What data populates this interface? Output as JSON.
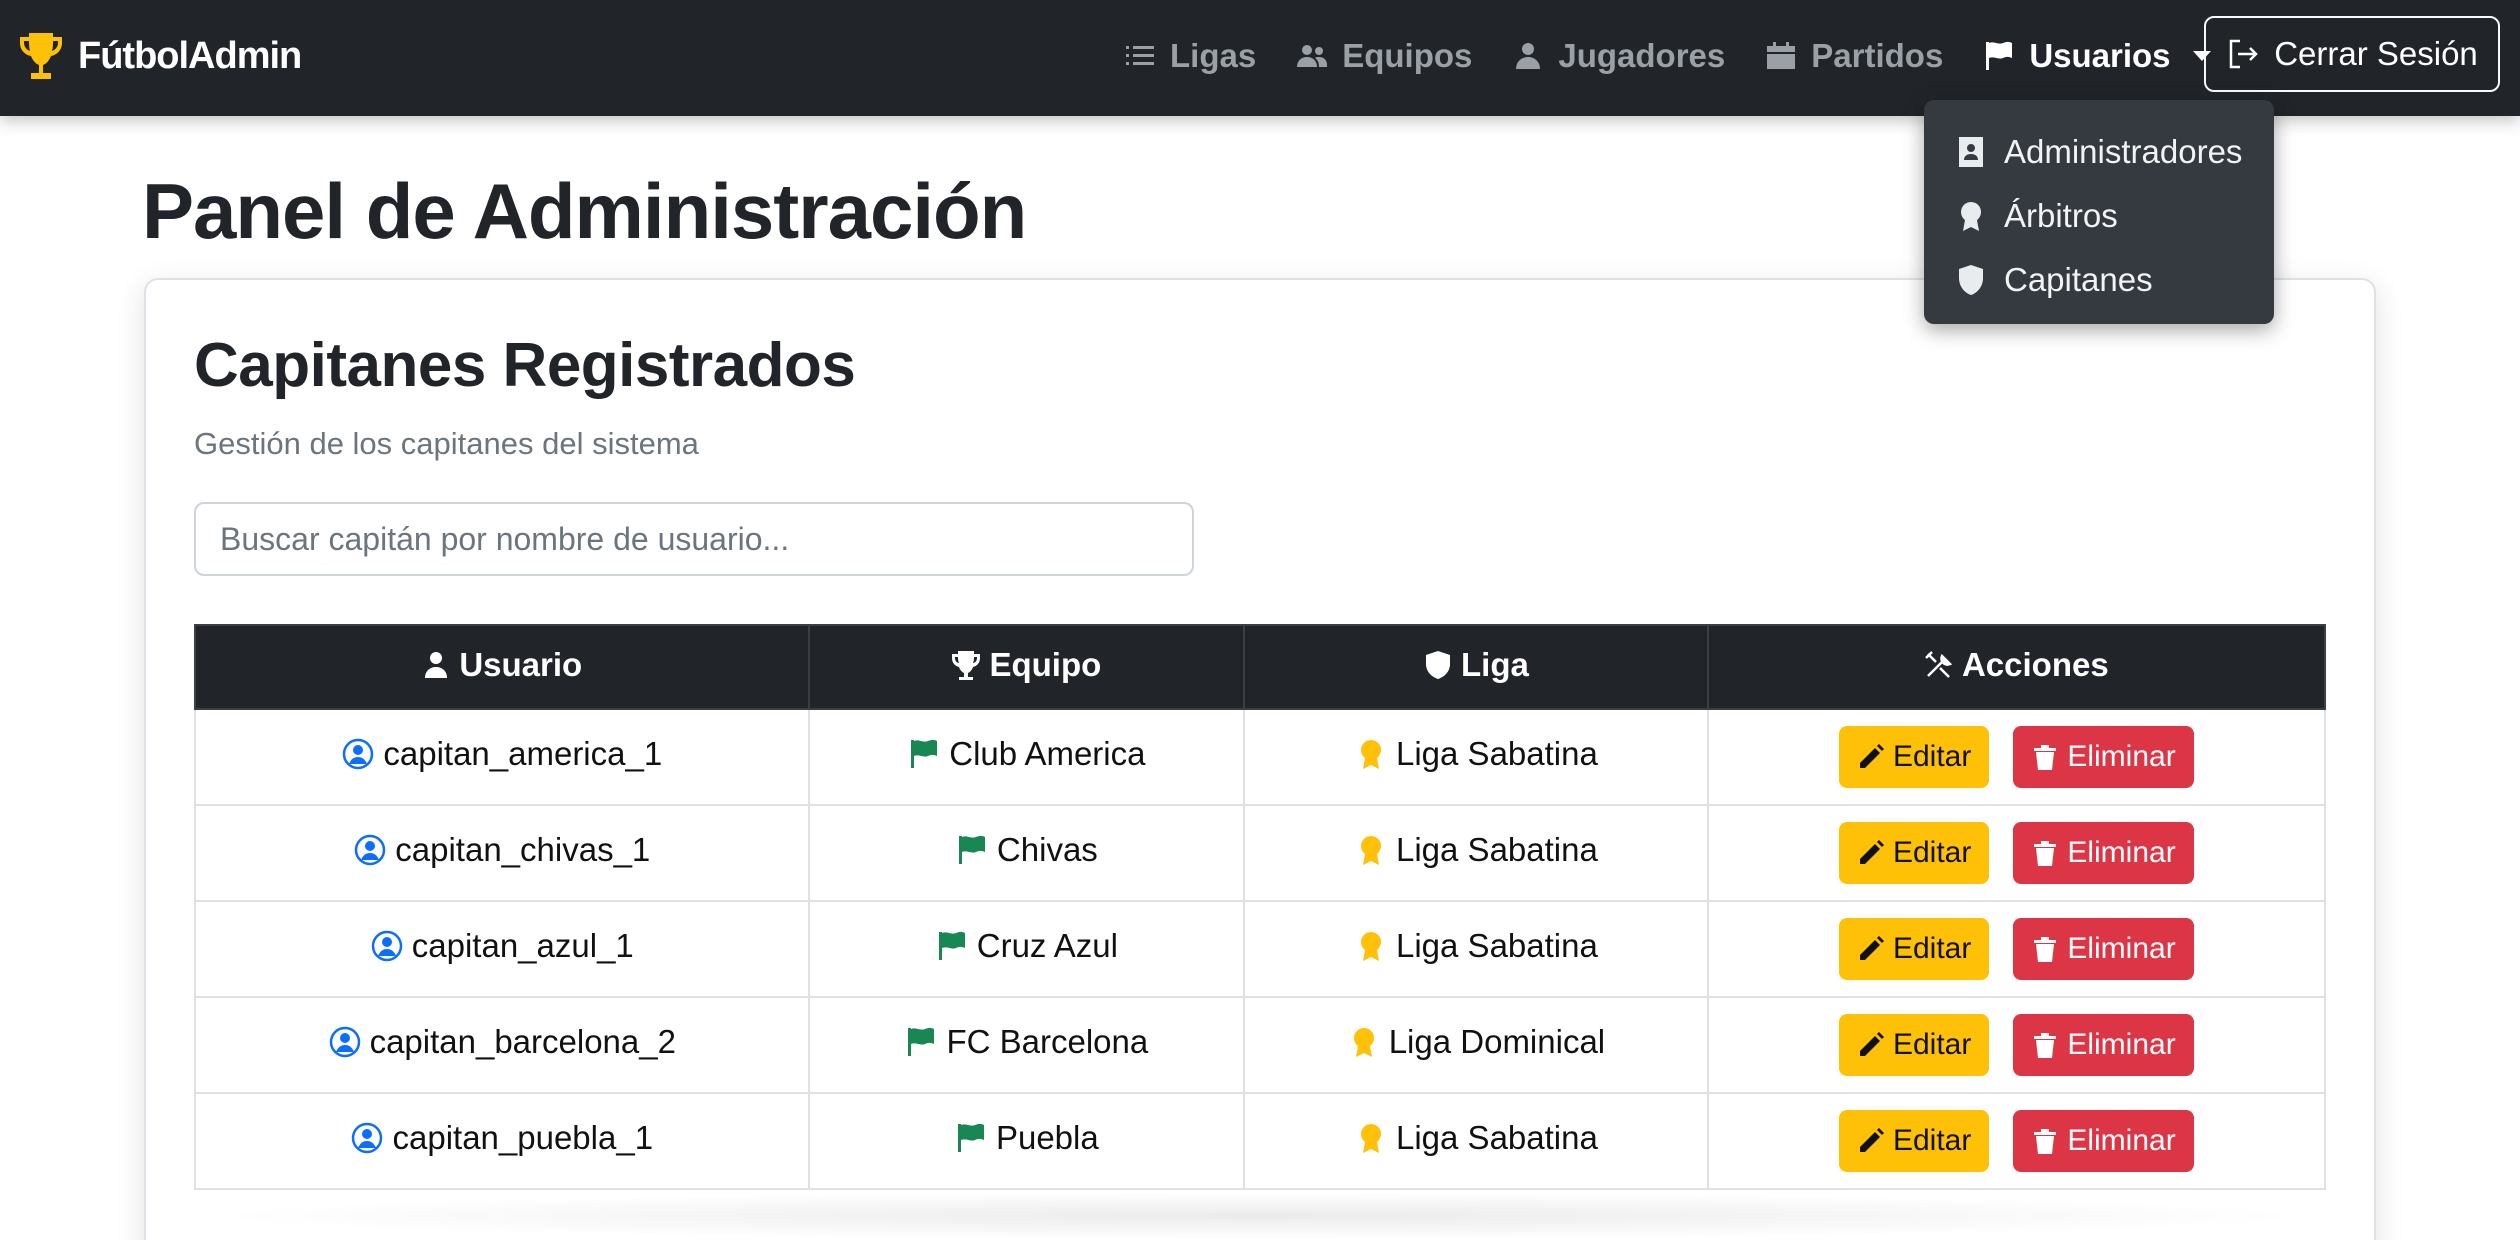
{
  "navbar": {
    "brand": "FútbolAdmin",
    "links": [
      {
        "label": "Ligas",
        "icon": "list-icon"
      },
      {
        "label": "Equipos",
        "icon": "users-icon"
      },
      {
        "label": "Jugadores",
        "icon": "user-icon"
      },
      {
        "label": "Partidos",
        "icon": "calendar-icon"
      },
      {
        "label": "Usuarios",
        "icon": "flag-icon",
        "active": true
      }
    ],
    "logout_label": "Cerrar Sesión"
  },
  "dropdown": {
    "items": [
      {
        "label": "Administradores",
        "icon": "id-badge-icon"
      },
      {
        "label": "Árbitros",
        "icon": "award-icon"
      },
      {
        "label": "Capitanes",
        "icon": "shield-icon"
      }
    ]
  },
  "main": {
    "page_title": "Panel de Administración",
    "card_title": "Capitanes Registrados",
    "card_subtitle": "Gestión de los capitanes del sistema",
    "search_placeholder": "Buscar capitán por nombre de usuario..."
  },
  "table": {
    "headers": {
      "user": "Usuario",
      "team": "Equipo",
      "league": "Liga",
      "actions": "Acciones"
    },
    "rows": [
      {
        "user": "capitan_america_1",
        "team": "Club America",
        "league": "Liga Sabatina"
      },
      {
        "user": "capitan_chivas_1",
        "team": "Chivas",
        "league": "Liga Sabatina"
      },
      {
        "user": "capitan_azul_1",
        "team": "Cruz Azul",
        "league": "Liga Sabatina"
      },
      {
        "user": "capitan_barcelona_2",
        "team": "FC Barcelona",
        "league": "Liga Dominical"
      },
      {
        "user": "capitan_puebla_1",
        "team": "Puebla",
        "league": "Liga Sabatina"
      }
    ],
    "edit_label": "Editar",
    "delete_label": "Eliminar"
  },
  "colors": {
    "navbar": "#212529",
    "trophy": "#ffc107",
    "user_icon": "#0d6efd",
    "flag_icon": "#198754",
    "award_icon": "#ffc107",
    "edit_button": "#ffc107",
    "delete_button": "#dc3545"
  }
}
